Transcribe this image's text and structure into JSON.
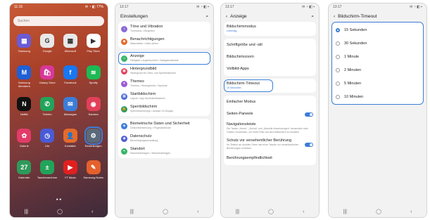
{
  "home": {
    "status_time": "11:15",
    "status_icons": "✉ ◔ ◧ 77%",
    "search_placeholder": "Suchen",
    "dots": "● ●",
    "apps": [
      {
        "label": "Samsung",
        "color": "#6b5bd6",
        "glyph": "▦",
        "icon": "samsung-folder-icon"
      },
      {
        "label": "Google",
        "color": "#e8e8e8",
        "glyph": "G",
        "icon": "google-folder-icon"
      },
      {
        "label": "Microsoft",
        "color": "#e8e8e8",
        "glyph": "▦",
        "icon": "microsoft-folder-icon"
      },
      {
        "label": "Play Store",
        "color": "#fff",
        "glyph": "▶",
        "icon": "play-store-icon"
      },
      {
        "label": "Samsung Members",
        "color": "#1f5fd6",
        "glyph": "M",
        "icon": "samsung-members-icon"
      },
      {
        "label": "Galaxy Store",
        "color": "#d8379a",
        "glyph": "🛍",
        "icon": "galaxy-store-icon"
      },
      {
        "label": "Facebook",
        "color": "#1877f2",
        "glyph": "f",
        "icon": "facebook-icon"
      },
      {
        "label": "Spotify",
        "color": "#1db954",
        "glyph": "≋",
        "icon": "spotify-icon"
      },
      {
        "label": "Netflix",
        "color": "#111",
        "glyph": "N",
        "icon": "netflix-icon"
      },
      {
        "label": "Telefon",
        "color": "#22a35a",
        "glyph": "✆",
        "icon": "phone-icon"
      },
      {
        "label": "Messages",
        "color": "#3b7dd8",
        "glyph": "✉",
        "icon": "messages-icon"
      },
      {
        "label": "Kamera",
        "color": "#e2405a",
        "glyph": "◉",
        "icon": "camera-icon"
      },
      {
        "label": "Galerie",
        "color": "#e33b6a",
        "glyph": "✿",
        "icon": "gallery-icon"
      },
      {
        "label": "Uhr",
        "color": "#4a5bd6",
        "glyph": "◷",
        "icon": "clock-icon"
      },
      {
        "label": "Kontakte",
        "color": "#e56a2c",
        "glyph": "👤",
        "icon": "contacts-icon"
      },
      {
        "label": "Einstellungen",
        "color": "#5a6a7a",
        "glyph": "⚙",
        "icon": "settings-icon"
      },
      {
        "label": "Kalender",
        "color": "#2f9a5a",
        "glyph": "27",
        "icon": "calendar-icon"
      },
      {
        "label": "Taschenrechner",
        "color": "#22a35a",
        "glyph": "±",
        "icon": "calculator-icon"
      },
      {
        "label": "YT Music",
        "color": "#e02020",
        "glyph": "▶",
        "icon": "yt-music-icon"
      },
      {
        "label": "Samsung Notes",
        "color": "#e5602c",
        "glyph": "✎",
        "icon": "notes-icon"
      }
    ]
  },
  "settings": {
    "status_time": "13:17",
    "status_icons": "✉ ◔ ◧ ▪",
    "title": "Einstellungen",
    "items": [
      {
        "t": "Töne und Vibration",
        "s": "Tonmodus • Klingelton",
        "c": "#8a6bd6",
        "g": "♪",
        "icon": "sound-icon"
      },
      {
        "t": "Benachrichtigungen",
        "s": "Statusleiste • Nicht stören",
        "c": "#e56a2c",
        "g": "◆",
        "icon": "notification-icon"
      },
      {
        "t": "Anzeige",
        "s": "Helligkeit • Augenkomfort • Navigationsleiste",
        "c": "#3ab56a",
        "g": "☼",
        "icon": "display-icon"
      },
      {
        "t": "Hintergrundbild",
        "s": "Hintergrund für Start- und Sperrbildschirm",
        "c": "#e2405a",
        "g": "▣",
        "icon": "wallpaper-icon"
      },
      {
        "t": "Themes",
        "s": "Themes • Hintergründe • Symbole",
        "c": "#9a5bd6",
        "g": "✦",
        "icon": "themes-icon"
      },
      {
        "t": "Startbildschirm",
        "s": "Layout • App-Symbolindikatoren",
        "c": "#4a6bd6",
        "g": "▦",
        "icon": "home-screen-icon"
      },
      {
        "t": "Sperrbildschirm",
        "s": "Sperrbildschirmtyp • Always On Display",
        "c": "#2f9a5a",
        "g": "🔒",
        "icon": "lock-screen-icon"
      },
      {
        "t": "Biometrische Daten und Sicherheit",
        "s": "Gesichtserkennung • Fingerabdrücke",
        "c": "#3b7dd8",
        "g": "◈",
        "icon": "security-icon"
      },
      {
        "t": "Datenschutz",
        "s": "Berechtigungsverwaltung",
        "c": "#4a5bd6",
        "g": "◉",
        "icon": "privacy-icon"
      },
      {
        "t": "Standort",
        "s": "Standortanfragen • Standortanfragen",
        "c": "#3ab56a",
        "g": "⌖",
        "icon": "location-icon"
      }
    ]
  },
  "display": {
    "status_time": "13:17",
    "status_icons": "✉ ◔ ◧ ▪",
    "title": "Anzeige",
    "dark_mode": {
      "t": "Bildschirmmodus",
      "s": "Lebendig"
    },
    "font": "Schriftgröße und -stil",
    "zoom": "Bildschirmzoom",
    "fullscreen": "Vollbild-Apps",
    "timeout": {
      "t": "Bildschirm-Timeout",
      "s": "15 Sekunden"
    },
    "easy_mode": "Einfacher Modus",
    "edge": "Seiten-Paneele",
    "navbar": {
      "t": "Navigationsleiste",
      "s": "Die Tasten „Home“, „Zurück“ und „Aktuelle Anwendungen“ verwenden oder Gesten verwenden, um mehr Platz auf dem Bildschirm zu erhalten"
    },
    "touch": {
      "t": "Schutz vor versehentlicher Berührung",
      "s": "Ihr Telefon an dunklen Orten wie einer Tasche vor versehentlichen Berührungen schützen."
    },
    "touch_sens": "Berührungsempfindlichkeit"
  },
  "timeout": {
    "status_time": "13:17",
    "status_icons": "✉ ◔ ◧ ▪",
    "title": "Bildschirm-Timeout",
    "options": [
      "15 Sekunden",
      "30 Sekunden",
      "1 Minute",
      "2 Minuten",
      "5 Minuten",
      "10 Minuten"
    ],
    "selected": 0
  },
  "nav": {
    "recents": "|||",
    "home": "◯",
    "back": "‹"
  },
  "colors": {
    "accent": "#3b7dd8"
  }
}
